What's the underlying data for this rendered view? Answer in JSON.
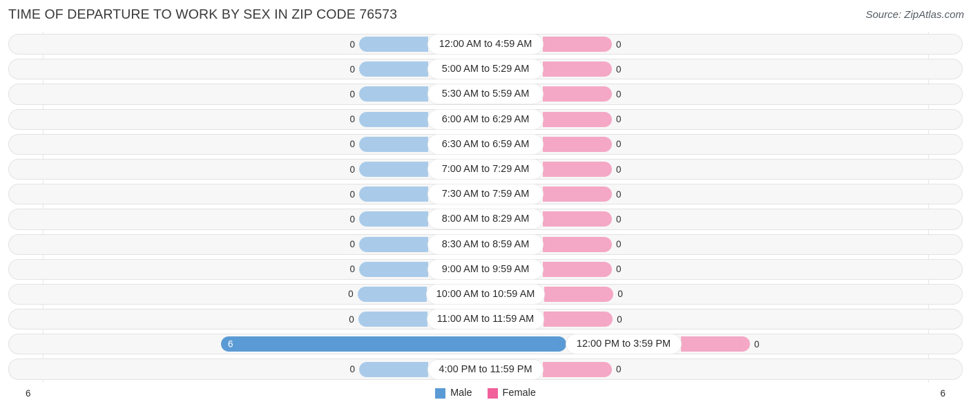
{
  "header": {
    "title": "TIME OF DEPARTURE TO WORK BY SEX IN ZIP CODE 76573",
    "source": "Source: ZipAtlas.com"
  },
  "legend": {
    "male_label": "Male",
    "female_label": "Female",
    "male_color": "#5b9bd5",
    "female_color": "#f2609c"
  },
  "axis": {
    "left_tick": "6",
    "right_tick": "6"
  },
  "chart_data": {
    "type": "bar",
    "orientation": "horizontal-diverging",
    "title": "TIME OF DEPARTURE TO WORK BY SEX IN ZIP CODE 76573",
    "xlabel": "",
    "ylabel": "",
    "xlim": [
      6,
      6
    ],
    "grid": false,
    "legend_position": "bottom-center",
    "categories": [
      "12:00 AM to 4:59 AM",
      "5:00 AM to 5:29 AM",
      "5:30 AM to 5:59 AM",
      "6:00 AM to 6:29 AM",
      "6:30 AM to 6:59 AM",
      "7:00 AM to 7:29 AM",
      "7:30 AM to 7:59 AM",
      "8:00 AM to 8:29 AM",
      "8:30 AM to 8:59 AM",
      "9:00 AM to 9:59 AM",
      "10:00 AM to 10:59 AM",
      "11:00 AM to 11:59 AM",
      "12:00 PM to 3:59 PM",
      "4:00 PM to 11:59 PM"
    ],
    "series": [
      {
        "name": "Male",
        "color": "#5b9bd5",
        "side": "left",
        "values": [
          0,
          0,
          0,
          0,
          0,
          0,
          0,
          0,
          0,
          0,
          0,
          0,
          6,
          0
        ]
      },
      {
        "name": "Female",
        "color": "#f2609c",
        "side": "right",
        "values": [
          0,
          0,
          0,
          0,
          0,
          0,
          0,
          0,
          0,
          0,
          0,
          0,
          0,
          0
        ]
      }
    ],
    "max_value": 6
  },
  "rows": [
    {
      "label": "12:00 AM to 4:59 AM",
      "male": "0",
      "female": "0"
    },
    {
      "label": "5:00 AM to 5:29 AM",
      "male": "0",
      "female": "0"
    },
    {
      "label": "5:30 AM to 5:59 AM",
      "male": "0",
      "female": "0"
    },
    {
      "label": "6:00 AM to 6:29 AM",
      "male": "0",
      "female": "0"
    },
    {
      "label": "6:30 AM to 6:59 AM",
      "male": "0",
      "female": "0"
    },
    {
      "label": "7:00 AM to 7:29 AM",
      "male": "0",
      "female": "0"
    },
    {
      "label": "7:30 AM to 7:59 AM",
      "male": "0",
      "female": "0"
    },
    {
      "label": "8:00 AM to 8:29 AM",
      "male": "0",
      "female": "0"
    },
    {
      "label": "8:30 AM to 8:59 AM",
      "male": "0",
      "female": "0"
    },
    {
      "label": "9:00 AM to 9:59 AM",
      "male": "0",
      "female": "0"
    },
    {
      "label": "10:00 AM to 10:59 AM",
      "male": "0",
      "female": "0"
    },
    {
      "label": "11:00 AM to 11:59 AM",
      "male": "0",
      "female": "0"
    },
    {
      "label": "12:00 PM to 3:59 PM",
      "male": "6",
      "female": "0"
    },
    {
      "label": "4:00 PM to 11:59 PM",
      "male": "0",
      "female": "0"
    }
  ]
}
